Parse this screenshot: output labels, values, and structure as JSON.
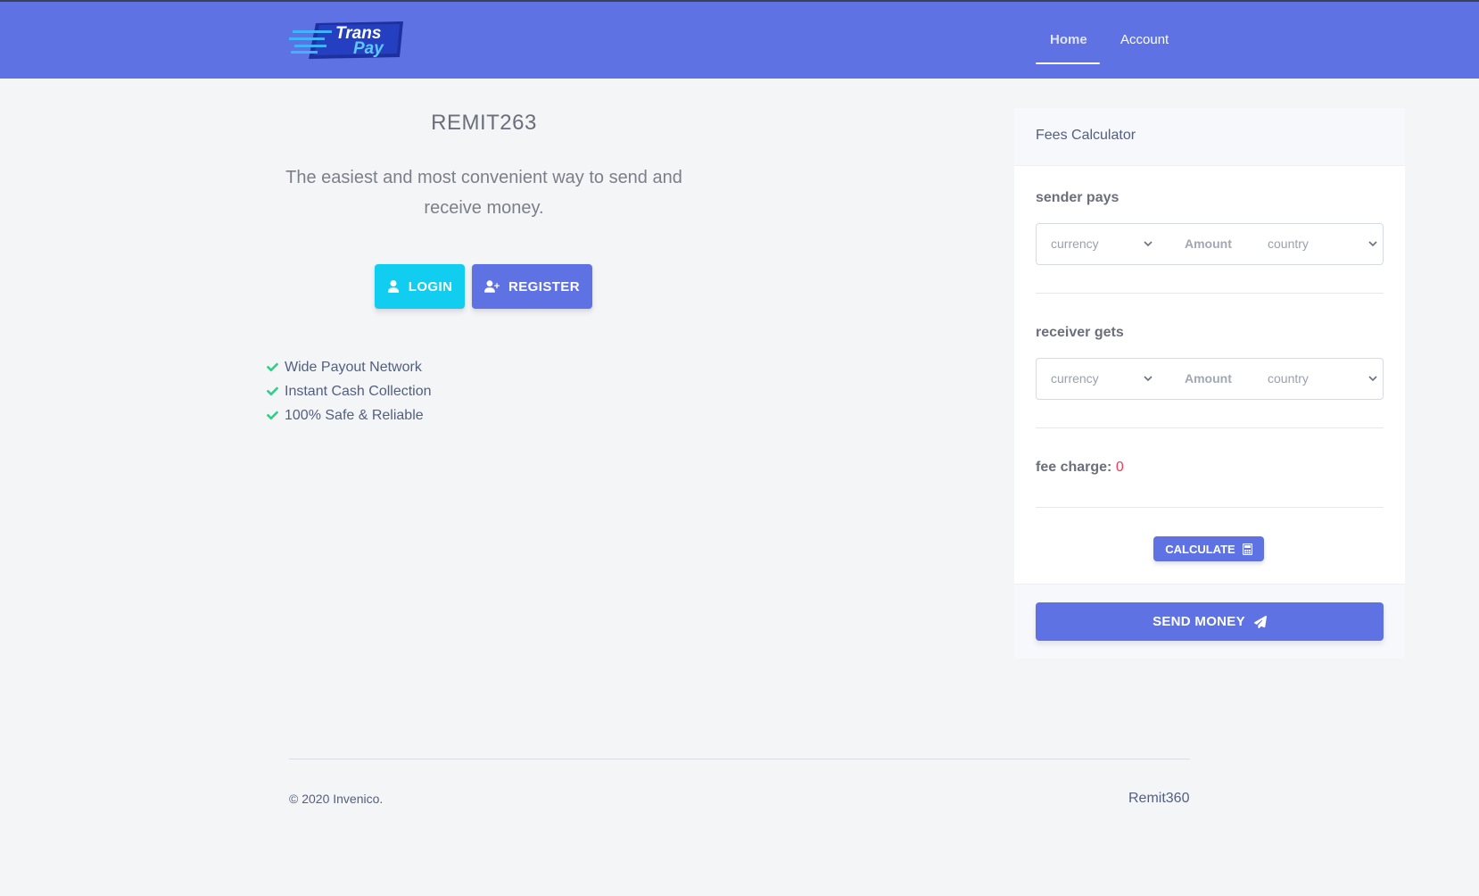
{
  "nav": {
    "logo_text": "Trans Pay",
    "logo_line1": "Trans",
    "logo_line2": "Pay",
    "home": "Home",
    "account": "Account"
  },
  "hero": {
    "title": "REMIT263",
    "tagline_line1": "The easiest and most convenient way to send and",
    "tagline_line2": "receive money.",
    "login_label": "LOGIN",
    "register_label": "REGISTER",
    "features": [
      "Wide Payout Network",
      "Instant Cash Collection",
      "100% Safe & Reliable"
    ]
  },
  "calculator": {
    "title": "Fees Calculator",
    "sender_label": "sender pays",
    "receiver_label": "receiver gets",
    "currency_placeholder": "currency",
    "amount_placeholder": "Amount",
    "country_placeholder": "country",
    "fee_label": "fee charge:",
    "fee_value": "0",
    "calculate_label": "CALCULATE",
    "send_money_label": "SEND MONEY"
  },
  "footer": {
    "copyright": "© 2020 Invenico.",
    "brand": "Remit360"
  },
  "colors": {
    "primary": "#5e72e4",
    "info": "#11cdef",
    "success": "#2dce89",
    "danger": "#f5365c",
    "background": "#f4f5f7"
  },
  "icons": [
    "user-icon",
    "user-plus-icon",
    "check-icon",
    "chevron-down-icon",
    "calculator-icon",
    "paper-plane-icon"
  ]
}
